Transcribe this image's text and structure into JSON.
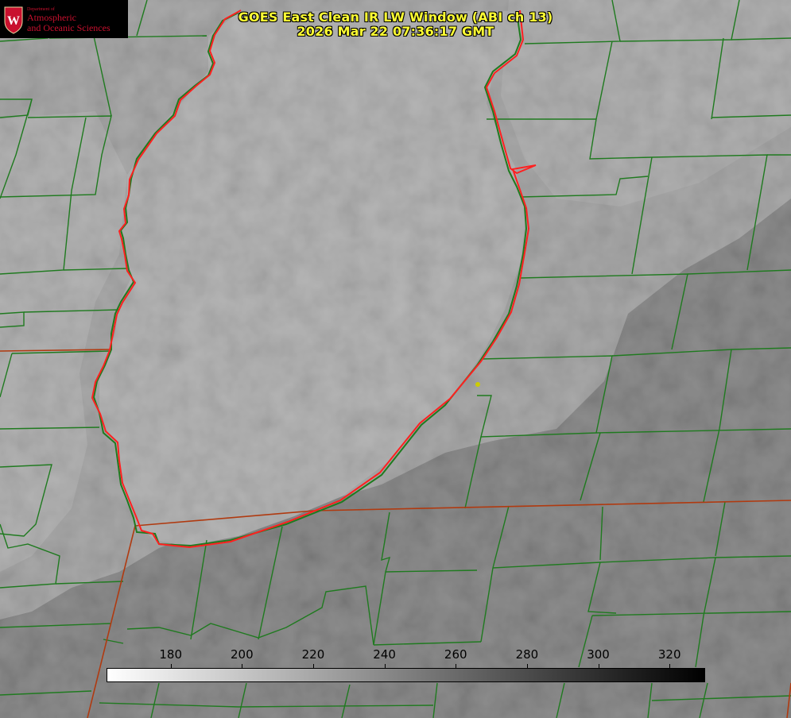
{
  "header": {
    "title": "GOES East Clean IR LW Window (ABI ch 13)",
    "timestamp": "2026 Mar 22 07:36:17 GMT"
  },
  "logo": {
    "dept": "Department of",
    "line1": "Atmospheric",
    "line2": "and Oceanic Sciences",
    "seal_letter": "W"
  },
  "colorbar": {
    "ticks": [
      "180",
      "200",
      "220",
      "240",
      "260",
      "280",
      "300",
      "320"
    ],
    "range": [
      162,
      330
    ],
    "start_color": "#ffffff",
    "end_color": "#000000"
  },
  "colors": {
    "county_lines": "#1f7a1f",
    "state_line": "#b03a10",
    "lake_outline": "#ff2020",
    "marker": "#cccc00",
    "title_text": "#ffff33"
  }
}
